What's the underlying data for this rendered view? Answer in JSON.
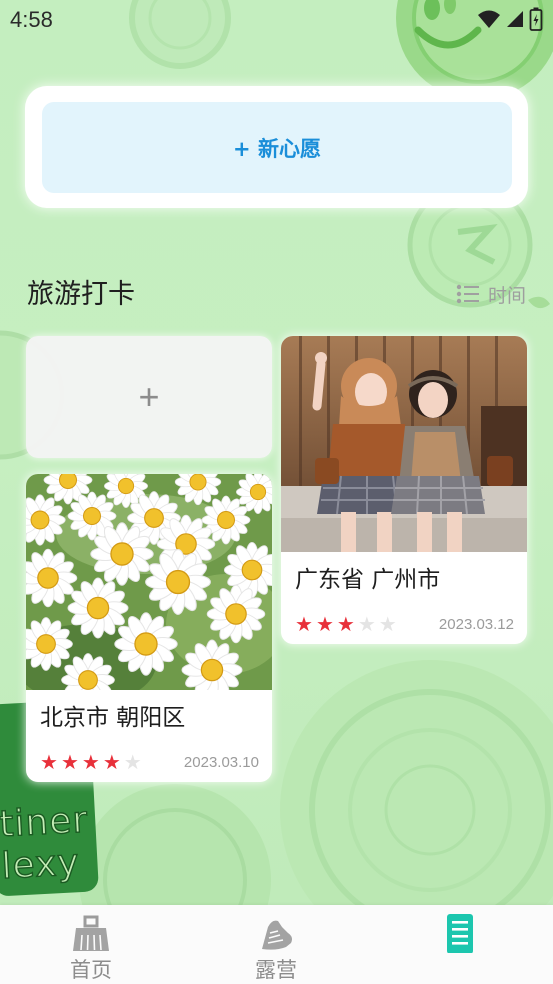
{
  "status_bar": {
    "time": "4:58",
    "icons": [
      "wifi-icon",
      "signal-icon",
      "battery-charging-icon"
    ]
  },
  "wish": {
    "button_label": "+ 新心愿"
  },
  "section": {
    "title": "旅游打卡",
    "sort_label": "时间",
    "sort_icon": "list-icon"
  },
  "add_card": {
    "label": "+"
  },
  "cards": [
    {
      "location": "广东省 广州市",
      "rating": 3,
      "max_rating": 5,
      "date": "2023.03.12"
    },
    {
      "location": "北京市 朝阳区",
      "rating": 4,
      "max_rating": 5,
      "date": "2023.03.10"
    }
  ],
  "background": {
    "decoration_text": [
      "tiner",
      "lexy"
    ]
  },
  "nav": {
    "items": [
      {
        "label": "首页",
        "icon": "broom-icon",
        "active": false
      },
      {
        "label": "露营",
        "icon": "sneaker-icon",
        "active": false
      },
      {
        "icon": "notes-icon",
        "active": true
      }
    ]
  },
  "colors": {
    "accent": "#1a8ed9",
    "wish_bg": "#e2f4fc",
    "star_filled": "#e8303a",
    "star_empty": "#e4e4e4",
    "nav_active": "#1cc6ae",
    "nav_inactive": "#9a9a9a"
  }
}
